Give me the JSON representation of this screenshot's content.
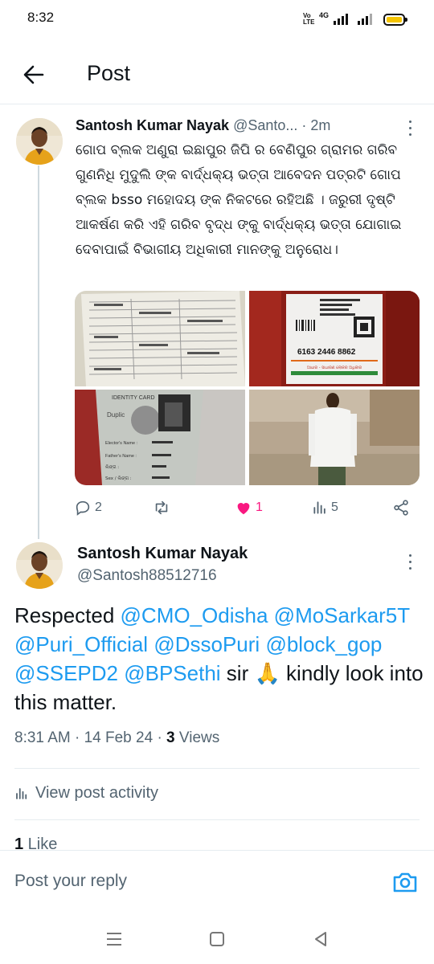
{
  "status_bar": {
    "time": "8:32",
    "volte": "Vo\nLTE",
    "network": "4G"
  },
  "header": {
    "title": "Post"
  },
  "tweet_parent": {
    "name": "Santosh Kumar Nayak",
    "handle": "@Santo...",
    "sep": " · ",
    "time": "2m",
    "text": "ଗୋପ ବ୍ଲକ ଅଣୁରା ଇଛାପୁର ଜିପି ର ବେଣିପୁର ଗ୍ରାମର ଗରିବ ଗୁଣନିଧି ମୁଦୁଲି ଙ୍କ ବାର୍ଦ୍ଧକ୍ୟ ଭତ୍ତା ଆବେଦନ ପତ୍ରଟି ଗୋପ ବ୍ଲକ bsso ମହୋଦୟ ଙ୍କ ନିକଟରେ ରହିଅଛି । ଜରୁରୀ ଦୃଷ୍ଟି ଆକର୍ଷଣ କରି ଏହି ଗରିବ ବୃଦ୍ଧ ଙ୍କୁ ବାର୍ଦ୍ଧକ୍ୟ ଭତ୍ତା ଯୋଗାଇ ଦେବାପାଇଁ ବିଭାଗୀୟ ଅଧିକାରୀ ମାନଙ୍କୁ ଅନୁରୋଧ।",
    "media": {
      "aadhaar_number": "6163 2446 8862",
      "aadhaar_tagline": "ଆଧାର - ସାଧାରଣ ଲୋକର ଅଧିକାର",
      "id_card_title": "IDENTITY CARD",
      "id_card_dup": "Duplic",
      "id_card_fields": [
        "Elector's Name :",
        "Father's Name :",
        "ଲିଙ୍ଗ :",
        "Sex / ଲିଙ୍ଗ :"
      ]
    },
    "stats": {
      "replies": "2",
      "retweets": "",
      "likes": "1",
      "views": "5"
    }
  },
  "tweet_main": {
    "name": "Santosh Kumar Nayak",
    "handle": "@Santosh88512716",
    "text_prefix": "Respected ",
    "mentions": [
      "@CMO_Odisha",
      "@MoSarkar5T",
      "@Puri_Official",
      "@DssoPuri",
      "@block_gop",
      "@SSEPD2",
      "@BPSethi"
    ],
    "text_suffix": " sir 🙏 kindly look into this matter.",
    "timestamp": "8:31 AM · 14 Feb 24 · ",
    "views_count": "3",
    "views_label": " Views",
    "activity_label": "View post activity",
    "likes_count": "1",
    "likes_label": " Like"
  },
  "reply": {
    "placeholder": "Post your reply"
  },
  "colors": {
    "accent": "#1d9bf0",
    "like": "#f91880",
    "text": "#0f1419",
    "muted": "#536471"
  },
  "icons": [
    "back-arrow-icon",
    "more-icon",
    "reply-icon",
    "retweet-icon",
    "heart-icon",
    "views-icon",
    "share-icon",
    "analytics-icon",
    "camera-icon",
    "menu-icon",
    "home-icon",
    "back-icon"
  ]
}
